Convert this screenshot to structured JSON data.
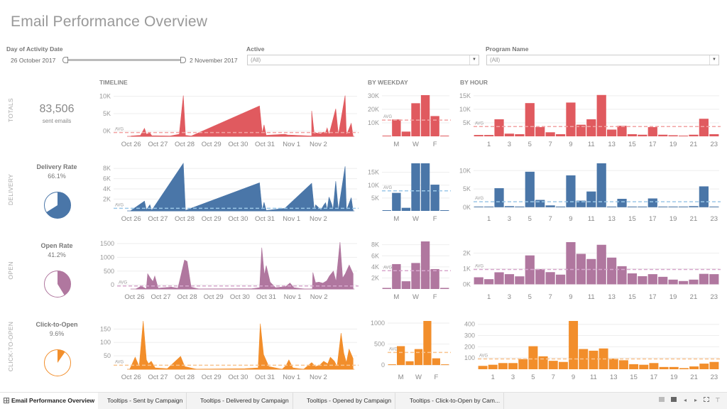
{
  "title": "Email Performance Overview",
  "filters": {
    "date": {
      "label": "Day of Activity Date",
      "start": "26 October 2017",
      "end": "2 November 2017"
    },
    "active": {
      "label": "Active",
      "value": "(All)"
    },
    "program": {
      "label": "Program Name",
      "value": "(All)"
    }
  },
  "sections": {
    "timeline": "TIMELINE",
    "weekday": "BY WEEKDAY",
    "hour": "BY HOUR"
  },
  "avg_label": "AVG",
  "rows": [
    {
      "key": "totals",
      "label": "TOTALS",
      "color": "#e05a5f",
      "avg_color": "#f2a3a3",
      "kpi": {
        "big": "83,506",
        "sub": "sent emails"
      }
    },
    {
      "key": "delivery",
      "label": "DELIVERY",
      "color": "#4a76a8",
      "avg_color": "#9cc8e8",
      "kpi": {
        "title": "Delivery Rate",
        "value": "66.1%",
        "fraction": 0.661
      }
    },
    {
      "key": "open",
      "label": "OPEN",
      "color": "#b0779f",
      "avg_color": "#d8a8ce",
      "kpi": {
        "title": "Open Rate",
        "value": "41.2%",
        "fraction": 0.412
      }
    },
    {
      "key": "cto",
      "label": "CLICK-TO-OPEN",
      "color": "#f28e2b",
      "avg_color": "#f9c48f",
      "kpi": {
        "title": "Click-to-Open",
        "value": "9.6%",
        "fraction": 0.096
      }
    }
  ],
  "chart_data": [
    {
      "id": "totals-timeline",
      "type": "area",
      "title": "TIMELINE",
      "x_ticks": [
        "Oct 26",
        "Oct 27",
        "Oct 28",
        "Oct 29",
        "Oct 30",
        "Oct 31",
        "Nov 1",
        "Nov 2"
      ],
      "y_ticks": [
        {
          "v": 0,
          "l": "0K"
        },
        {
          "v": 5000,
          "l": "5K"
        },
        {
          "v": 10000,
          "l": "10K"
        }
      ],
      "ylim": [
        -1500,
        10500
      ],
      "avg": -400,
      "peaks": [
        [
          0.55,
          -1400
        ],
        [
          0.9,
          -1200
        ],
        [
          1.05,
          800
        ],
        [
          1.12,
          -900
        ],
        [
          1.25,
          -500
        ],
        [
          1.32,
          -1300
        ],
        [
          2.0,
          -1400
        ],
        [
          2.35,
          -900
        ],
        [
          2.5,
          10200
        ],
        [
          2.58,
          -1200
        ],
        [
          2.8,
          -1400
        ],
        [
          5.35,
          7200
        ],
        [
          5.45,
          -600
        ],
        [
          5.52,
          1800
        ],
        [
          5.6,
          -1200
        ],
        [
          6.3,
          -900
        ],
        [
          6.4,
          -1100
        ],
        [
          7.3,
          -1400
        ],
        [
          7.3,
          5800
        ],
        [
          7.4,
          -900
        ],
        [
          7.45,
          -500
        ],
        [
          7.65,
          -800
        ],
        [
          7.7,
          -400
        ],
        [
          7.75,
          -300
        ],
        [
          7.82,
          -400
        ],
        [
          7.88,
          900
        ],
        [
          7.95,
          -1100
        ],
        [
          8.2,
          6400
        ],
        [
          8.3,
          -1100
        ],
        [
          8.55,
          10200
        ],
        [
          8.6,
          -1200
        ],
        [
          8.78,
          2200
        ],
        [
          8.85,
          -1400
        ]
      ]
    },
    {
      "id": "delivery-timeline",
      "type": "area",
      "x_ticks": [
        "Oct 26",
        "Oct 27",
        "Oct 28",
        "Oct 29",
        "Oct 30",
        "Oct 31",
        "Nov 1",
        "Nov 2"
      ],
      "y_ticks": [
        {
          "v": 2000,
          "l": "2K"
        },
        {
          "v": 4000,
          "l": "4K"
        },
        {
          "v": 6000,
          "l": "6K"
        },
        {
          "v": 8000,
          "l": "8K"
        }
      ],
      "ylim": [
        -300,
        9000
      ],
      "avg": 200,
      "peaks": [
        [
          0.55,
          -200
        ],
        [
          1.05,
          1600
        ],
        [
          1.12,
          -100
        ],
        [
          1.25,
          900
        ],
        [
          1.32,
          -200
        ],
        [
          2.5,
          9000
        ],
        [
          2.58,
          -200
        ],
        [
          5.35,
          5200
        ],
        [
          5.45,
          -200
        ],
        [
          5.52,
          1400
        ],
        [
          5.6,
          -200
        ],
        [
          6.3,
          200
        ],
        [
          7.3,
          5100
        ],
        [
          7.4,
          -200
        ],
        [
          7.45,
          900
        ],
        [
          7.65,
          -100
        ],
        [
          7.75,
          800
        ],
        [
          7.82,
          1300
        ],
        [
          7.88,
          -100
        ],
        [
          7.95,
          2400
        ],
        [
          8.05,
          1000
        ],
        [
          8.1,
          -100
        ],
        [
          8.2,
          5500
        ],
        [
          8.3,
          -200
        ],
        [
          8.55,
          8400
        ],
        [
          8.6,
          -200
        ],
        [
          8.78,
          2300
        ],
        [
          8.85,
          -200
        ]
      ]
    },
    {
      "id": "open-timeline",
      "type": "area",
      "x_ticks": [
        "Oct 26",
        "Oct 27",
        "Oct 28",
        "Oct 29",
        "Oct 30",
        "Oct 31",
        "Nov 1",
        "Nov 2"
      ],
      "y_ticks": [
        {
          "v": 0,
          "l": "0"
        },
        {
          "v": 500,
          "l": "500"
        },
        {
          "v": 1000,
          "l": "1000"
        },
        {
          "v": 1500,
          "l": "1500"
        }
      ],
      "ylim": [
        -150,
        1550
      ],
      "avg": -40,
      "peaks": [
        [
          0.6,
          -150
        ],
        [
          0.8,
          -50
        ],
        [
          1.0,
          -140
        ],
        [
          1.05,
          400
        ],
        [
          1.15,
          250
        ],
        [
          1.25,
          120
        ],
        [
          1.32,
          320
        ],
        [
          1.45,
          -120
        ],
        [
          1.95,
          -80
        ],
        [
          2.2,
          -120
        ],
        [
          2.45,
          900
        ],
        [
          2.55,
          850
        ],
        [
          2.7,
          -80
        ],
        [
          3.0,
          -150
        ],
        [
          5.0,
          -140
        ],
        [
          5.3,
          -100
        ],
        [
          5.38,
          1350
        ],
        [
          5.48,
          350
        ],
        [
          5.55,
          700
        ],
        [
          5.7,
          100
        ],
        [
          5.9,
          -100
        ],
        [
          6.3,
          -60
        ],
        [
          6.45,
          70
        ],
        [
          6.6,
          -100
        ],
        [
          7.0,
          -150
        ],
        [
          7.3,
          -150
        ],
        [
          7.32,
          450
        ],
        [
          7.42,
          80
        ],
        [
          7.55,
          100
        ],
        [
          7.7,
          60
        ],
        [
          7.85,
          150
        ],
        [
          7.95,
          320
        ],
        [
          8.1,
          500
        ],
        [
          8.2,
          120
        ],
        [
          8.35,
          1550
        ],
        [
          8.45,
          250
        ],
        [
          8.55,
          400
        ],
        [
          8.7,
          720
        ],
        [
          8.85,
          400
        ]
      ]
    },
    {
      "id": "cto-timeline",
      "type": "area",
      "x_ticks": [
        "Oct 26",
        "Oct 27",
        "Oct 28",
        "Oct 29",
        "Oct 30",
        "Oct 31",
        "Nov 1",
        "Nov 2"
      ],
      "y_ticks": [
        {
          "v": 50,
          "l": "50"
        },
        {
          "v": 100,
          "l": "100"
        },
        {
          "v": 150,
          "l": "150"
        }
      ],
      "ylim": [
        0,
        180
      ],
      "avg": 15,
      "peaks": [
        [
          0.5,
          0
        ],
        [
          0.7,
          45
        ],
        [
          0.85,
          10
        ],
        [
          1.0,
          180
        ],
        [
          1.12,
          35
        ],
        [
          1.2,
          20
        ],
        [
          1.3,
          30
        ],
        [
          1.45,
          5
        ],
        [
          1.9,
          2
        ],
        [
          2.4,
          48
        ],
        [
          2.55,
          10
        ],
        [
          3.0,
          0
        ],
        [
          4.8,
          2
        ],
        [
          5.3,
          5
        ],
        [
          5.38,
          170
        ],
        [
          5.5,
          55
        ],
        [
          5.7,
          10
        ],
        [
          6.2,
          0
        ],
        [
          6.35,
          15
        ],
        [
          6.45,
          35
        ],
        [
          6.6,
          5
        ],
        [
          7.0,
          0
        ],
        [
          7.3,
          25
        ],
        [
          7.45,
          10
        ],
        [
          7.6,
          15
        ],
        [
          7.75,
          30
        ],
        [
          7.9,
          20
        ],
        [
          8.0,
          45
        ],
        [
          8.15,
          30
        ],
        [
          8.25,
          10
        ],
        [
          8.4,
          135
        ],
        [
          8.5,
          60
        ],
        [
          8.6,
          25
        ],
        [
          8.7,
          75
        ],
        [
          8.85,
          40
        ]
      ]
    },
    {
      "id": "totals-weekday",
      "type": "bar",
      "title": "BY WEEKDAY",
      "categories": [
        "S",
        "M",
        "T",
        "W",
        "T",
        "F",
        "S"
      ],
      "tick_labels": [
        "",
        "M",
        "",
        "W",
        "",
        "F",
        ""
      ],
      "values": [
        300,
        12500,
        3500,
        24500,
        30500,
        15000,
        300
      ],
      "y_ticks": [
        {
          "v": 10000,
          "l": "10K"
        },
        {
          "v": 20000,
          "l": "20K"
        },
        {
          "v": 30000,
          "l": "30K"
        }
      ],
      "ylim": [
        0,
        31000
      ],
      "avg": 12000
    },
    {
      "id": "delivery-weekday",
      "type": "bar",
      "categories": [
        "S",
        "M",
        "T",
        "W",
        "T",
        "F",
        "S"
      ],
      "tick_labels": [
        "",
        "M",
        "",
        "W",
        "",
        "F",
        ""
      ],
      "values": [
        0,
        7000,
        1200,
        18500,
        18500,
        10200,
        0
      ],
      "y_ticks": [
        {
          "v": 5000,
          "l": "5K"
        },
        {
          "v": 10000,
          "l": "10K"
        },
        {
          "v": 15000,
          "l": "15K"
        }
      ],
      "ylim": [
        0,
        18500
      ],
      "avg": 7800
    },
    {
      "id": "open-weekday",
      "type": "bar",
      "categories": [
        "S",
        "M",
        "T",
        "W",
        "T",
        "F",
        "S"
      ],
      "tick_labels": [
        "",
        "M",
        "",
        "W",
        "",
        "F",
        ""
      ],
      "values": [
        200,
        4500,
        1400,
        4700,
        8600,
        3600,
        200
      ],
      "y_ticks": [
        {
          "v": 2000,
          "l": "2K"
        },
        {
          "v": 4000,
          "l": "4K"
        },
        {
          "v": 6000,
          "l": "6K"
        },
        {
          "v": 8000,
          "l": "8K"
        }
      ],
      "ylim": [
        0,
        8600
      ],
      "avg": 3300
    },
    {
      "id": "cto-weekday",
      "type": "bar",
      "categories": [
        "S",
        "M",
        "T",
        "W",
        "T",
        "F",
        "S"
      ],
      "tick_labels": [
        "",
        "M",
        "",
        "W",
        "",
        "F",
        ""
      ],
      "values": [
        5,
        450,
        90,
        380,
        1050,
        160,
        5
      ],
      "y_ticks": [
        {
          "v": 0,
          "l": "0"
        },
        {
          "v": 500,
          "l": "500"
        },
        {
          "v": 1000,
          "l": "1000"
        }
      ],
      "ylim": [
        -100,
        1050
      ],
      "avg": 300
    },
    {
      "id": "totals-hour",
      "type": "bar",
      "title": "BY HOUR",
      "categories": [
        0,
        1,
        2,
        3,
        4,
        5,
        6,
        7,
        8,
        9,
        10,
        11,
        12,
        13,
        14,
        15,
        16,
        17,
        18,
        19,
        20,
        21,
        22,
        23
      ],
      "values": [
        500,
        500,
        6300,
        1000,
        800,
        12300,
        3400,
        1500,
        800,
        12500,
        4300,
        6300,
        15300,
        2500,
        3900,
        800,
        600,
        3400,
        600,
        400,
        200,
        600,
        6500,
        800
      ],
      "y_ticks": [
        {
          "v": 5000,
          "l": "5K"
        },
        {
          "v": 10000,
          "l": "10K"
        },
        {
          "v": 15000,
          "l": "15K"
        }
      ],
      "ylim": [
        0,
        15500
      ],
      "avg": 3600
    },
    {
      "id": "delivery-hour",
      "type": "bar",
      "categories": [
        0,
        1,
        2,
        3,
        4,
        5,
        6,
        7,
        8,
        9,
        10,
        11,
        12,
        13,
        14,
        15,
        16,
        17,
        18,
        19,
        20,
        21,
        22,
        23
      ],
      "values": [
        0,
        0,
        5200,
        300,
        200,
        9700,
        2000,
        500,
        0,
        8700,
        1800,
        4300,
        12000,
        100,
        2300,
        0,
        0,
        2400,
        0,
        0,
        0,
        300,
        5700,
        0
      ],
      "y_ticks": [
        {
          "v": 0,
          "l": "0K"
        },
        {
          "v": 5000,
          "l": "5K"
        },
        {
          "v": 10000,
          "l": "10K"
        }
      ],
      "ylim": [
        -1000,
        12000
      ],
      "avg": 1500
    },
    {
      "id": "open-hour",
      "type": "bar",
      "categories": [
        0,
        1,
        2,
        3,
        4,
        5,
        6,
        7,
        8,
        9,
        10,
        11,
        12,
        13,
        14,
        15,
        16,
        17,
        18,
        19,
        20,
        21,
        22,
        23
      ],
      "values": [
        450,
        330,
        770,
        650,
        510,
        1850,
        970,
        780,
        620,
        2700,
        1950,
        1620,
        2530,
        1710,
        1160,
        700,
        520,
        650,
        480,
        300,
        210,
        300,
        670,
        650
      ],
      "y_ticks": [
        {
          "v": 0,
          "l": "0K"
        },
        {
          "v": 1000,
          "l": "1K"
        },
        {
          "v": 2000,
          "l": "2K"
        }
      ],
      "ylim": [
        -300,
        2700
      ],
      "avg": 950
    },
    {
      "id": "cto-hour",
      "type": "bar",
      "categories": [
        0,
        1,
        2,
        3,
        4,
        5,
        6,
        7,
        8,
        9,
        10,
        11,
        12,
        13,
        14,
        15,
        16,
        17,
        18,
        19,
        20,
        21,
        22,
        23
      ],
      "values": [
        30,
        40,
        55,
        55,
        90,
        205,
        115,
        75,
        65,
        430,
        180,
        165,
        185,
        95,
        80,
        45,
        40,
        55,
        20,
        20,
        10,
        25,
        50,
        65
      ],
      "y_ticks": [
        {
          "v": 100,
          "l": "100"
        },
        {
          "v": 200,
          "l": "200"
        },
        {
          "v": 300,
          "l": "300"
        },
        {
          "v": 400,
          "l": "400"
        }
      ],
      "ylim": [
        0,
        430
      ],
      "avg": 92
    }
  ],
  "hour_tick_labels": [
    "1",
    "3",
    "5",
    "7",
    "9",
    "11",
    "13",
    "15",
    "17",
    "19",
    "21",
    "23"
  ],
  "tabs": [
    {
      "label": "Email Performance Overview",
      "active": true
    },
    {
      "label": "Tooltips - Sent by Campaign",
      "active": false
    },
    {
      "label": "Tooltips - Delivered by Campaign",
      "active": false
    },
    {
      "label": "Tooltips - Opened by Campaign",
      "active": false
    },
    {
      "label": "Tooltips - Click-to-Open by Cam...",
      "active": false
    }
  ],
  "controls": [
    "grid-view-icon",
    "single-view-icon",
    "prev-icon",
    "next-icon",
    "fullscreen-icon",
    "present-icon"
  ]
}
